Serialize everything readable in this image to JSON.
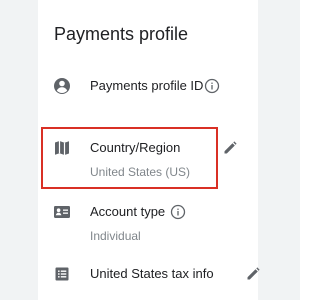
{
  "page": {
    "title": "Payments profile"
  },
  "rows": [
    {
      "label": "Payments profile ID",
      "icon": "account-circle-icon",
      "action_icon": "info-icon"
    },
    {
      "label": "Country/Region",
      "value": "United States (US)",
      "icon": "map-icon",
      "action_icon": "pencil-edit-icon",
      "highlighted": true
    },
    {
      "label": "Account type",
      "value": "Individual",
      "icon": "account-card-icon",
      "action_icon": "info-icon"
    },
    {
      "label": "United States tax info",
      "icon": "tax-document-icon",
      "action_icon": "pencil-edit-icon"
    }
  ],
  "colors": {
    "highlight": "#d93025",
    "icon": "#5f6368",
    "text": "#202124",
    "secondary_text": "#80868b",
    "gutter": "#f1f3f4"
  }
}
